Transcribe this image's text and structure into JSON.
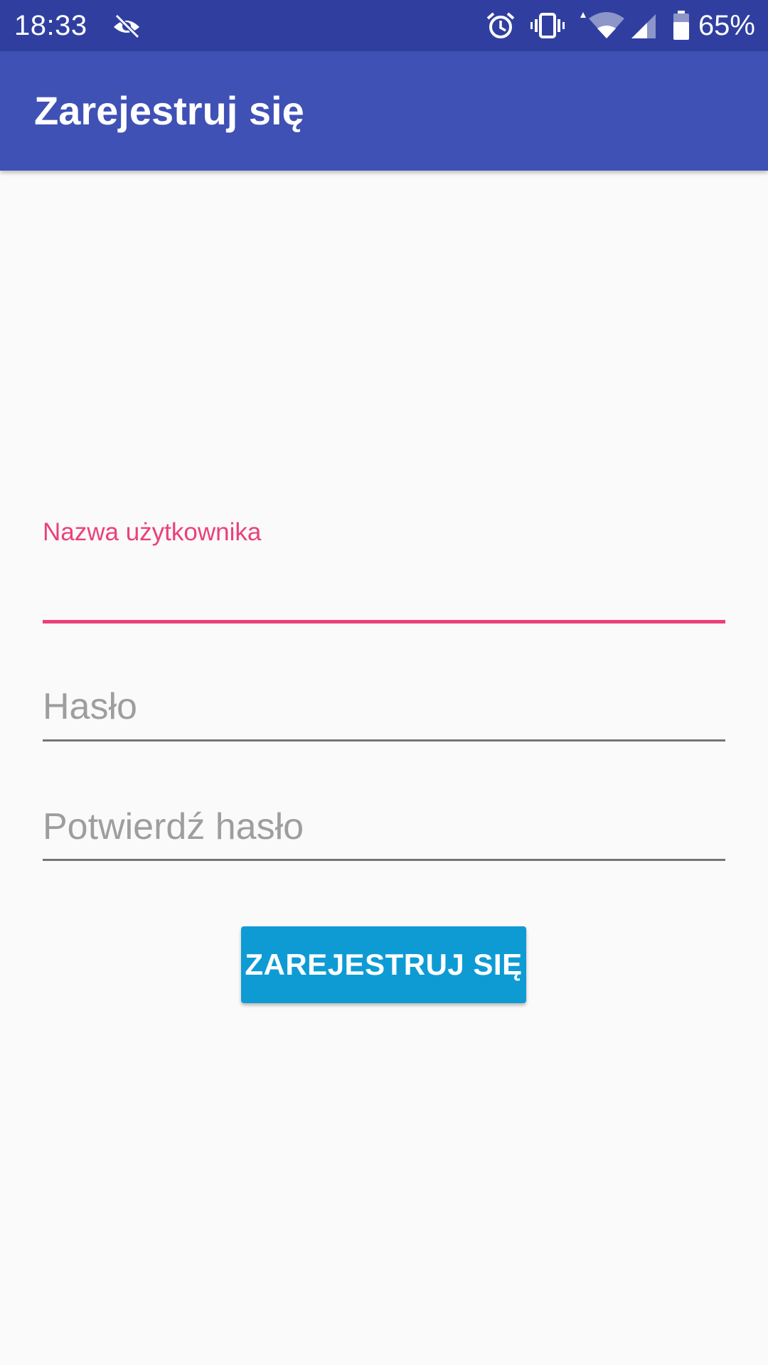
{
  "status_bar": {
    "time": "18:33",
    "battery_percent": "65%",
    "icons": [
      "eye-off-icon",
      "alarm-icon",
      "vibrate-icon",
      "wifi-icon",
      "signal-icon",
      "battery-icon"
    ],
    "background": "#303f9f"
  },
  "app_bar": {
    "title": "Zarejestruj się",
    "background": "#3f51b5"
  },
  "form": {
    "username": {
      "label": "Nazwa użytkownika",
      "value": "",
      "focused": true
    },
    "password": {
      "placeholder": "Hasło",
      "value": ""
    },
    "confirm_password": {
      "placeholder": "Potwierdź hasło",
      "value": ""
    },
    "submit_label": "ZAREJESTRUJ SIĘ"
  },
  "colors": {
    "accent": "#ec407a",
    "button": "#0e9bd4",
    "hint": "#9e9e9e"
  }
}
